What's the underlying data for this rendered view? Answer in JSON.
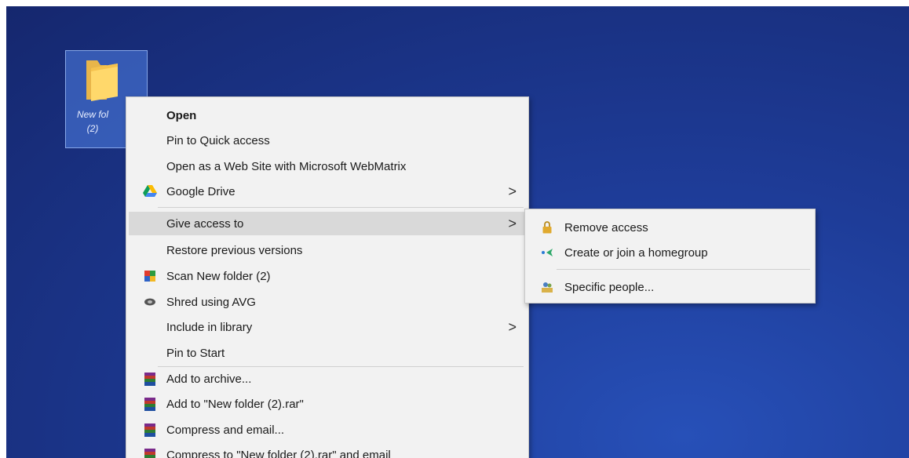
{
  "desktop": {
    "folder_label_line1": "New fol",
    "folder_label_line2": "(2)"
  },
  "context_menu": {
    "items": [
      {
        "label": "Open",
        "bold": true
      },
      {
        "label": "Pin to Quick access"
      },
      {
        "label": "Open as a Web Site with Microsoft WebMatrix"
      },
      {
        "label": "Google Drive",
        "icon": "google-drive-icon",
        "submenu": true
      },
      {
        "label": "Give access to",
        "submenu": true,
        "highlighted": true
      },
      {
        "label": "Restore previous versions"
      },
      {
        "label": "Scan New folder (2)",
        "icon": "antivirus-scan-icon"
      },
      {
        "label": "Shred using AVG",
        "icon": "avg-shred-icon"
      },
      {
        "label": "Include in library",
        "submenu": true
      },
      {
        "label": "Pin to Start"
      },
      {
        "label": "Add to archive...",
        "icon": "winrar-icon"
      },
      {
        "label": "Add to \"New folder (2).rar\"",
        "icon": "winrar-icon"
      },
      {
        "label": "Compress and email...",
        "icon": "winrar-icon"
      },
      {
        "label": "Compress to \"New folder (2).rar\" and email",
        "icon": "winrar-icon"
      }
    ],
    "submenu_arrow": ">"
  },
  "submenu": {
    "items": [
      {
        "label": "Remove access",
        "icon": "lock-icon"
      },
      {
        "label": "Create or join a homegroup",
        "icon": "homegroup-icon"
      },
      {
        "label": "Specific people...",
        "icon": "people-icon"
      }
    ]
  }
}
